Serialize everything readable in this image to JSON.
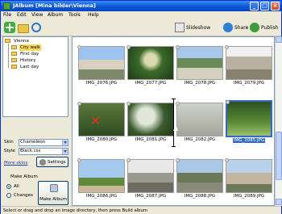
{
  "window": {
    "title": "JAlbum [Mina bilder\\Vienna]"
  },
  "menu": [
    "File",
    "Edit",
    "View",
    "Album",
    "Tools",
    "Help"
  ],
  "toolbar": {
    "slideshow": "Slideshow",
    "share": "Share",
    "publish": "Publish"
  },
  "tree": {
    "root": "Vienna",
    "items": [
      {
        "label": "City walk",
        "selected": true
      },
      {
        "label": "First day",
        "selected": false
      },
      {
        "label": "History",
        "selected": false
      },
      {
        "label": "Last day",
        "selected": false
      }
    ]
  },
  "settings": {
    "skin_label": "Skin",
    "skin_value": "Chameleon",
    "style_label": "Style",
    "style_value": "Black.css",
    "more_skins": "More skins",
    "settings_button": "Settings"
  },
  "make_album": {
    "group_label": "Make Album",
    "option_all": "All",
    "option_changes": "Changes",
    "selected_option": "All",
    "button": "Make Album"
  },
  "thumbnails": [
    "IMG_2076.JPG",
    "IMG_2077.JPG",
    "IMG_2078.JPG",
    "IMG_2079.JPG",
    "IMG_2080.JPG",
    "IMG_2081.JPG",
    "IMG_2082.JPG",
    "IMG_2085.JPG",
    "IMG_2086.JPG",
    "IMG_2087.JPG",
    "IMG_2088.JPG",
    "IMG_2089.JPG"
  ],
  "selected_thumbnail": "IMG_2085.JPG",
  "status": "Select or drag and drop an image directory, then press Build album"
}
